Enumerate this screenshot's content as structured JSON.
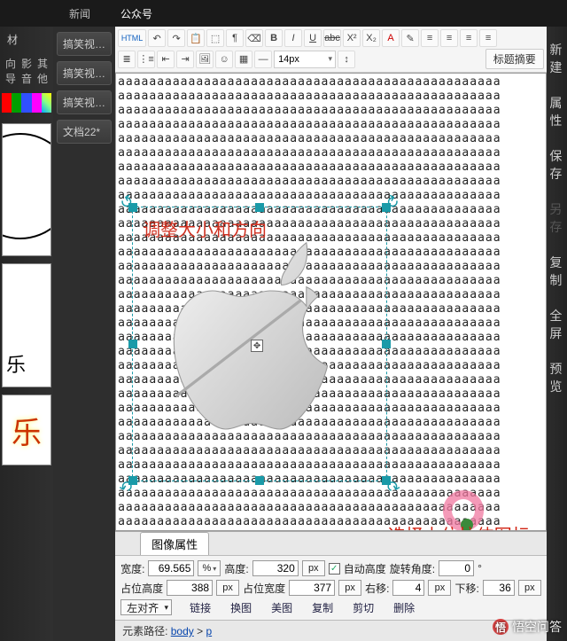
{
  "top_tabs": {
    "news": "新闻",
    "official": "公众号"
  },
  "left": {
    "title": "材",
    "tabs": {
      "guide": "向导",
      "media": "影音",
      "other": "其他"
    },
    "thumb2_label": "乐",
    "thumb3_label": "乐"
  },
  "doc_tabs": [
    "搞笑视…",
    "搞笑视…",
    "搞笑视…",
    "文档22*"
  ],
  "toolbar": {
    "row1": {
      "html": "HTML",
      "bold": "B",
      "italic": "I",
      "underline": "U",
      "strike": "abc",
      "sup": "X²",
      "sub": "X₂",
      "font_color": "A"
    },
    "row2": {
      "font_size": "14px"
    },
    "summary": "标题摘要"
  },
  "canvas": {
    "text_line": "aaaaaaaaaaaaaaaaaaaaaaaaaaaaaaaaaaaaaaaaaaaaaaaaa",
    "annotation1": "调整大小和方向",
    "annotation2": "选择占位拉伸图标",
    "move_glyph": "✥"
  },
  "props": {
    "tab": "图像属性",
    "width_label": "宽度:",
    "width_value": "69.565",
    "width_unit": "%",
    "height_label": "高度:",
    "height_value": "320",
    "height_unit": "px",
    "auto_h_label": "自动高度",
    "auto_h_checked": "✓",
    "rotate_label": "旋转角度:",
    "rotate_value": "0",
    "ph_h_label": "占位高度",
    "ph_h_value": "388",
    "ph_h_unit": "px",
    "ph_w_label": "占位宽度",
    "ph_w_value": "377",
    "ph_w_unit": "px",
    "right_label": "右移:",
    "right_value": "4",
    "right_unit": "px",
    "down_label": "下移:",
    "down_value": "36",
    "down_unit": "px",
    "align_label": "左对齐",
    "actions": {
      "link": "链接",
      "replace": "换图",
      "beautify": "美图",
      "copy": "复制",
      "cut": "剪切",
      "delete": "删除"
    }
  },
  "path": {
    "label": "元素路径:",
    "body": "body",
    "p": "p"
  },
  "right_menu": {
    "new": "新 建",
    "props": "属 性",
    "save": "保 存",
    "saveas": "另 存",
    "copy": "复 制",
    "full": "全 屏",
    "preview": "预 览"
  },
  "watermark": "悟空问答"
}
